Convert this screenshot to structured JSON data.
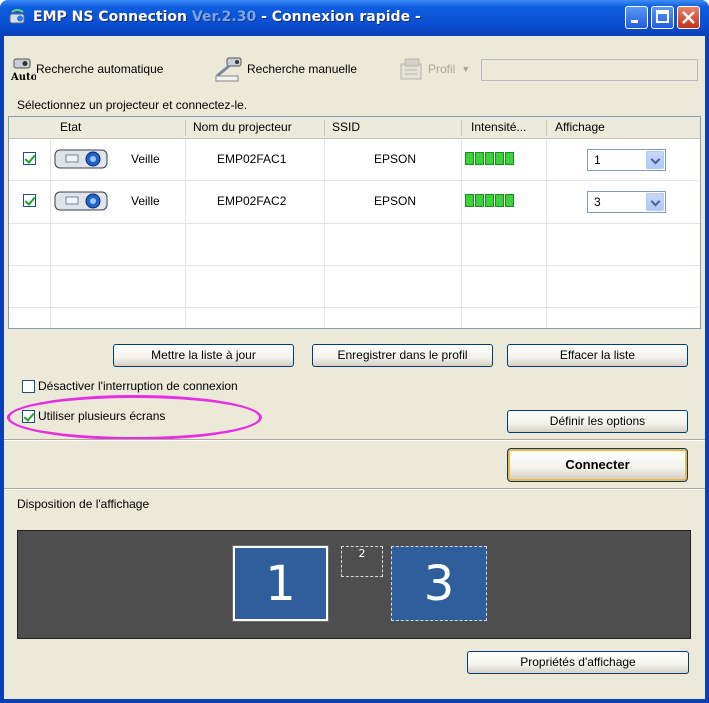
{
  "window": {
    "app_name": "EMP NS Connection",
    "version": "Ver.2.30",
    "subtitle": "- Connexion rapide -"
  },
  "toolbar": {
    "auto_search_label": "Recherche automatique",
    "auto_badge": "Auto",
    "manual_search_label": "Recherche manuelle",
    "profile_label": "Profil",
    "profile_value": ""
  },
  "hint": "Sélectionnez un projecteur et connectez-le.",
  "table": {
    "columns": [
      "Etat",
      "Nom du projecteur",
      "SSID",
      "Intensité...",
      "Affichage"
    ],
    "rows": [
      {
        "checked": true,
        "status": "Veille",
        "name": "EMP02FAC1",
        "ssid": "EPSON",
        "signal_bars": 5,
        "display": "1"
      },
      {
        "checked": true,
        "status": "Veille",
        "name": "EMP02FAC2",
        "ssid": "EPSON",
        "signal_bars": 5,
        "display": "3"
      }
    ]
  },
  "buttons": {
    "refresh": "Mettre la liste à jour",
    "save_profile": "Enregistrer dans le profil",
    "clear_list": "Effacer la liste",
    "set_options": "Définir les options",
    "connect": "Connecter",
    "display_properties": "Propriétés d'affichage"
  },
  "options": {
    "disable_interrupt": {
      "label": "Désactiver l'interruption de connexion",
      "checked": false
    },
    "multi_screen": {
      "label": "Utiliser plusieurs écrans",
      "checked": true
    }
  },
  "layout": {
    "label": "Disposition de l'affichage",
    "screens": [
      "1",
      "2",
      "3"
    ]
  },
  "colors": {
    "titlebar": "#0a4ed0",
    "highlight": "#e62fe0",
    "signal": "#3bd23b",
    "screen": "#2f5e9c"
  }
}
